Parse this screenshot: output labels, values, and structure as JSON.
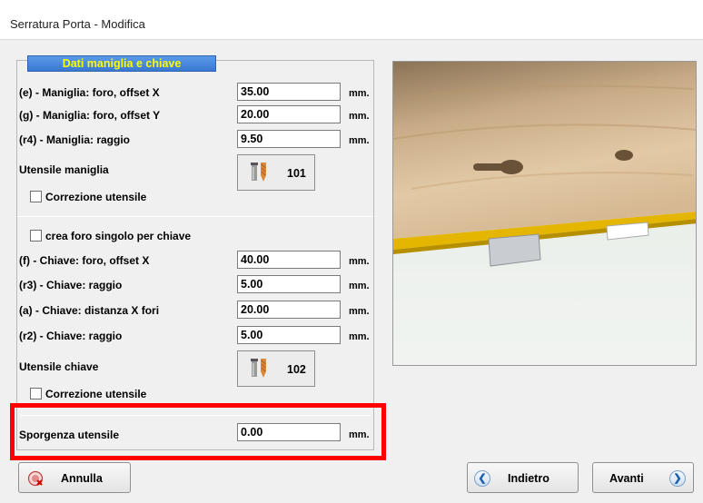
{
  "window": {
    "title": "Serratura Porta - Modifica"
  },
  "group": {
    "title": "Dati maniglia e chiave"
  },
  "unit": "mm.",
  "handle": {
    "offset_x": {
      "label": "(e)  - Maniglia: foro, offset X",
      "value": "35.00"
    },
    "offset_y": {
      "label": "(g)  - Maniglia: foro, offset Y",
      "value": "20.00"
    },
    "radius": {
      "label": "(r4) - Maniglia: raggio",
      "value": "9.50"
    },
    "tool": {
      "label": "Utensile maniglia",
      "number": "101",
      "icon": "drill-bit-icon"
    },
    "correction": {
      "label": "Correzione utensile",
      "checked": false
    }
  },
  "key": {
    "single_hole": {
      "label": "crea foro singolo per chiave",
      "checked": false
    },
    "offset_x": {
      "label": "(f)  - Chiave: foro, offset X",
      "value": "40.00"
    },
    "radius3": {
      "label": "(r3) - Chiave: raggio",
      "value": "5.00"
    },
    "distance": {
      "label": "(a)  - Chiave: distanza X fori",
      "value": "20.00"
    },
    "radius2": {
      "label": "(r2) - Chiave: raggio",
      "value": "5.00"
    },
    "tool": {
      "label": "Utensile chiave",
      "number": "102",
      "icon": "drill-bit-icon"
    },
    "correction": {
      "label": "Correzione utensile",
      "checked": false
    }
  },
  "protrusion": {
    "label": "Sporgenza utensile",
    "value": "0.00"
  },
  "buttons": {
    "cancel": {
      "label": "Annulla",
      "icon": "cancel-icon"
    },
    "back": {
      "label": "Indietro",
      "icon": "arrow-left-icon"
    },
    "next": {
      "label": "Avanti",
      "icon": "arrow-right-icon"
    }
  },
  "colors": {
    "group_header_bg": "#3a79d1",
    "group_header_text": "#ffff00",
    "highlight": "#ff0000"
  }
}
